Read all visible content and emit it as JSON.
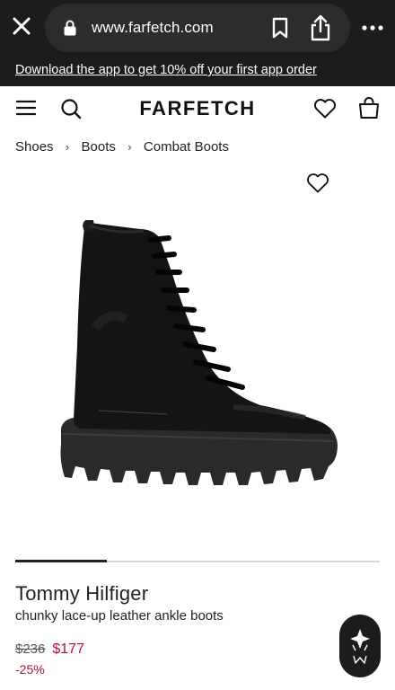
{
  "browser": {
    "url": "www.farfetch.com",
    "icons": [
      "close-icon",
      "lock-icon",
      "bookmark-icon",
      "share-icon",
      "more-icon"
    ]
  },
  "promo": {
    "text": "Download the app to get 10% off your first app order"
  },
  "header": {
    "logo": "FARFETCH",
    "icons": [
      "menu-icon",
      "search-icon",
      "heart-icon",
      "bag-icon"
    ]
  },
  "breadcrumb": {
    "items": [
      "Shoes",
      "Boots",
      "Combat Boots"
    ],
    "separator": "›"
  },
  "gallery": {
    "progress": 0.25
  },
  "product": {
    "brand": "Tommy Hilfiger",
    "description": "chunky lace-up leather ankle boots",
    "original_price": "$236",
    "sale_price": "$177",
    "discount": "-25%"
  },
  "colors": {
    "chrome": "#1c1c1e",
    "sale": "#b2142e",
    "text": "#222222"
  }
}
